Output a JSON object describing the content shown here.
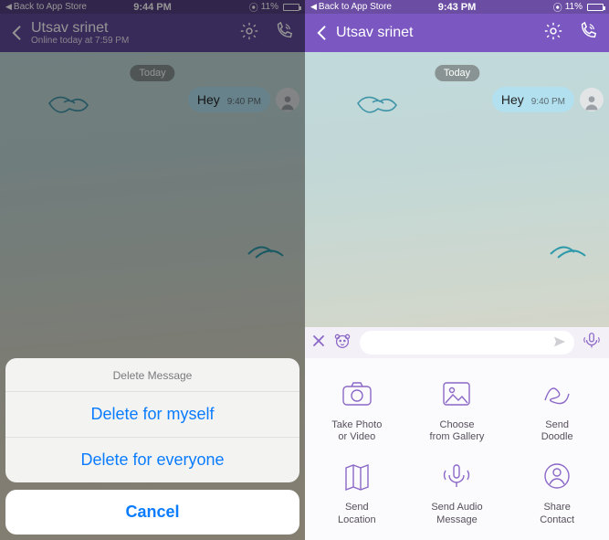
{
  "status": {
    "back_label": "Back to App Store",
    "battery_pct": "11%",
    "alarm_icon": "⦿"
  },
  "left": {
    "time": "9:44 PM",
    "nav": {
      "title": "Utsav srinet",
      "subtitle": "Online today at 7:59 PM"
    },
    "chat": {
      "day": "Today",
      "msg_text": "Hey",
      "msg_time": "9:40 PM"
    },
    "sheet": {
      "title": "Delete Message",
      "opt1": "Delete for myself",
      "opt2": "Delete for everyone",
      "cancel": "Cancel"
    }
  },
  "right": {
    "time": "9:43 PM",
    "nav": {
      "title": "Utsav srinet"
    },
    "chat": {
      "day": "Today",
      "msg_text": "Hey",
      "msg_time": "9:40 PM"
    },
    "attach": {
      "a1": "Take Photo\nor Video",
      "a2": "Choose\nfrom Gallery",
      "a3": "Send\nDoodle",
      "a4": "Send\nLocation",
      "a5": "Send Audio\nMessage",
      "a6": "Share\nContact"
    }
  }
}
